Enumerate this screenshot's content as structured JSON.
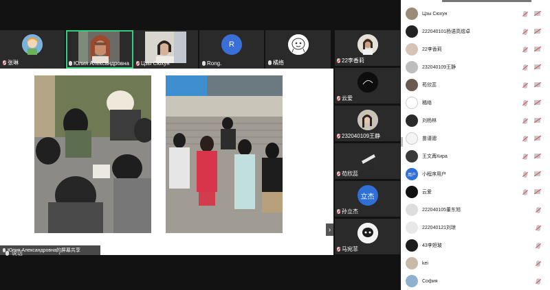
{
  "top_tiles": [
    {
      "name": "张琳",
      "mic": "off"
    },
    {
      "name": "Юлия Александровна",
      "mic": "on"
    },
    {
      "name": "Цзы Сюхун",
      "mic": "off"
    },
    {
      "name": "Rong.",
      "mic": "on",
      "initial": "R"
    },
    {
      "name": "橘络",
      "mic": "on"
    }
  ],
  "right_tiles": [
    {
      "name": "22李香莉"
    },
    {
      "name": "云爱"
    },
    {
      "name": "232040109王静"
    },
    {
      "name": "苟欣蕊"
    },
    {
      "name": "孙立杰",
      "initial": "立杰"
    },
    {
      "name": "马宛菲"
    }
  ],
  "share": {
    "tag": "Юлия Александровна的屏幕共享"
  },
  "bottom": {
    "speaking": "说话"
  },
  "participants": [
    {
      "name": "Цзы Сюхун"
    },
    {
      "name": "222040101杨语高煜卓"
    },
    {
      "name": "22李香莉"
    },
    {
      "name": "232040109王静"
    },
    {
      "name": "苟欣蕊"
    },
    {
      "name": "橘络"
    },
    {
      "name": "刘杨林"
    },
    {
      "name": "苗谨骢"
    },
    {
      "name": "王文苒Кира"
    },
    {
      "name": "小程序用户",
      "initial": "用户"
    },
    {
      "name": "云爱"
    },
    {
      "name": "222040105董东旭"
    },
    {
      "name": "222040121刘琼"
    },
    {
      "name": "43李妲玻"
    },
    {
      "name": "kei"
    },
    {
      "name": "София"
    }
  ],
  "colors": {
    "panel_bg": "#ffffff",
    "stage_bg": "#121212",
    "active_speaker": "#2fd27a",
    "rong_avatar": "#3a6fd8",
    "lijie_avatar": "#2f6fd6",
    "user_avatar": "#2f6fd6"
  }
}
